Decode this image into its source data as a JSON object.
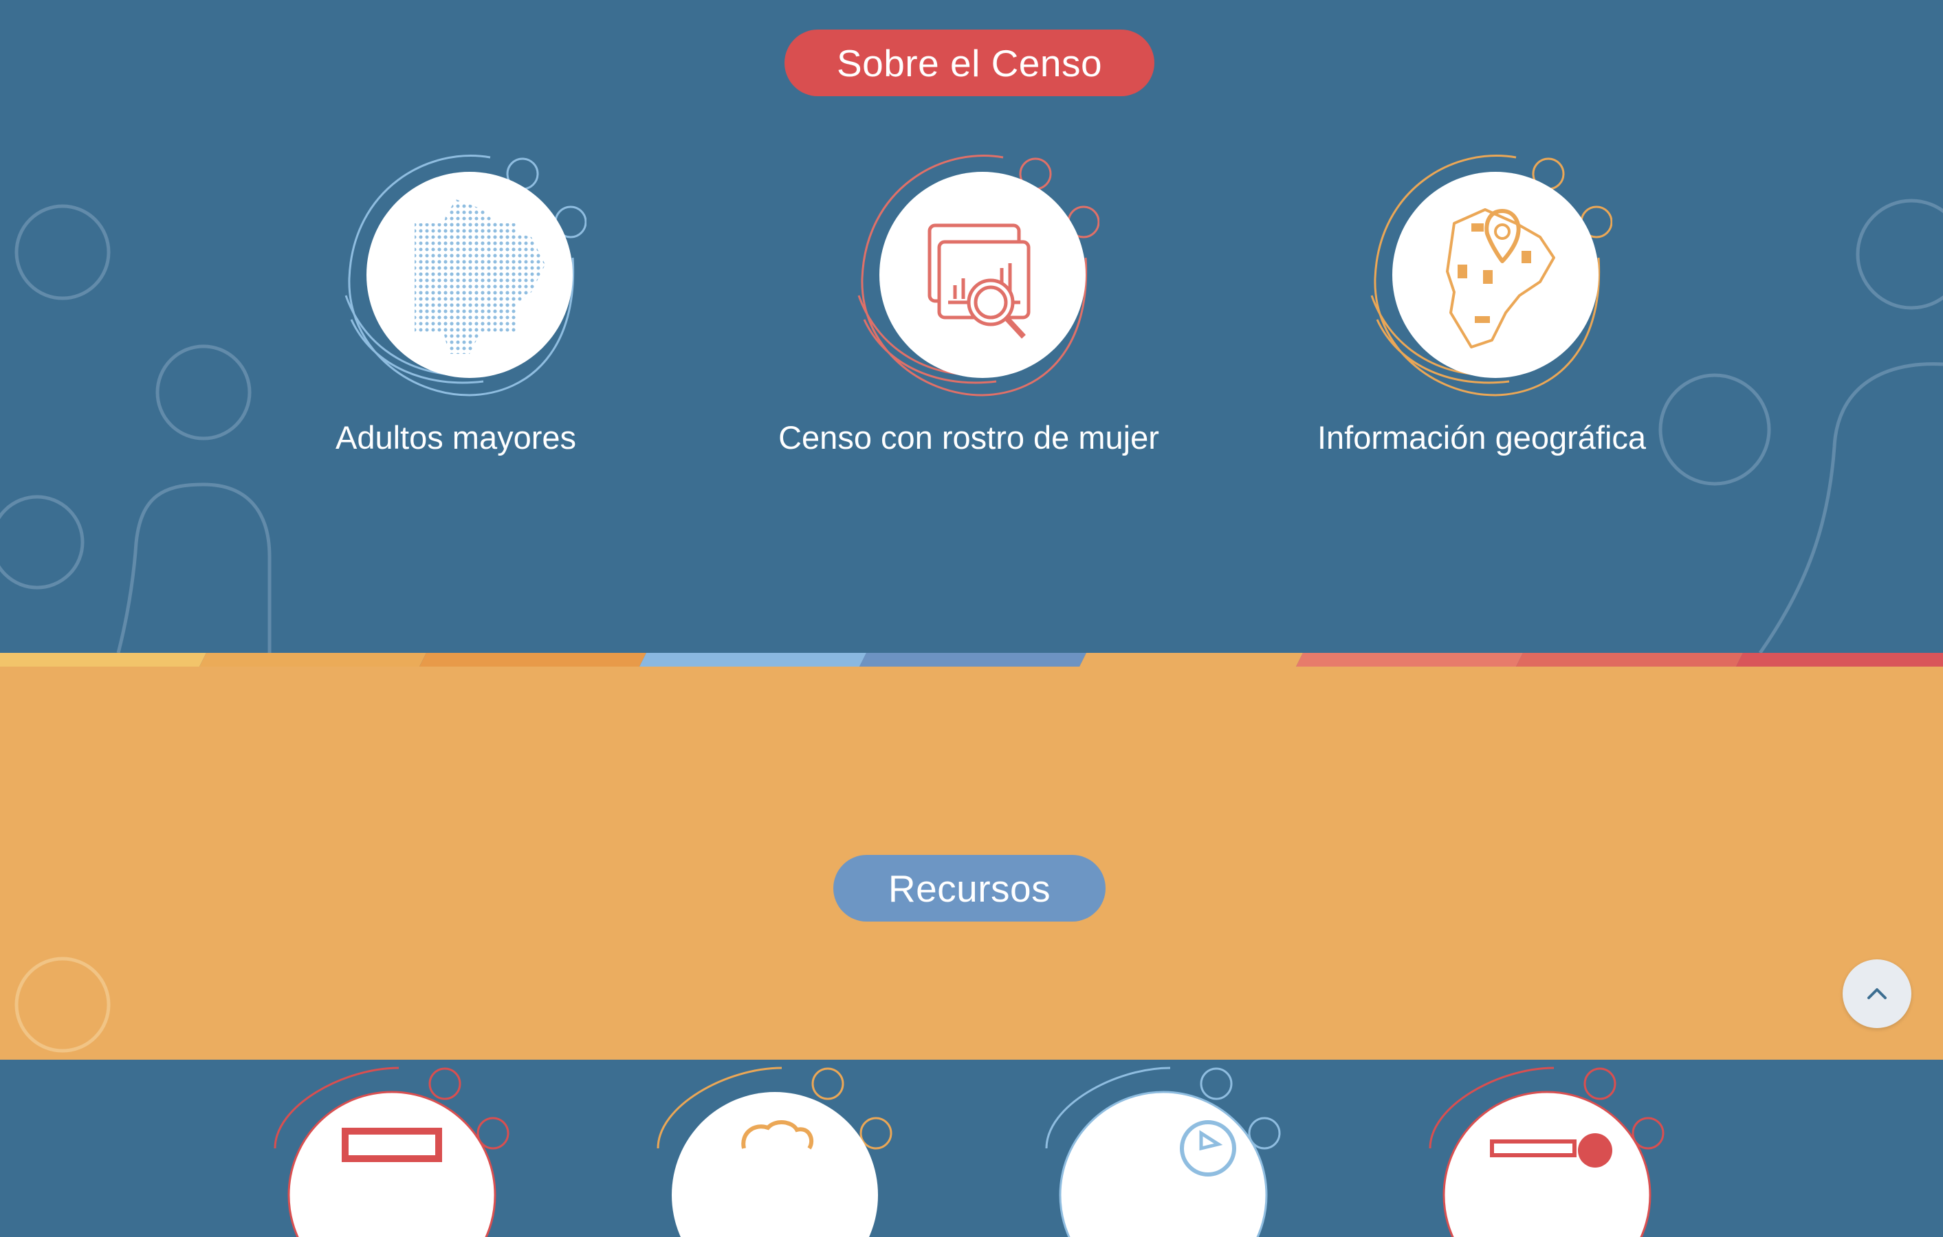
{
  "sections": {
    "about": {
      "title": "Sobre el Censo",
      "cards": [
        {
          "label": "Adultos mayores",
          "icon": "ecuador-dots-map-icon",
          "color": "#8fbde0"
        },
        {
          "label": "Censo con rostro de mujer",
          "icon": "data-analysis-magnifier-icon",
          "color": "#e07068"
        },
        {
          "label": "Información geográfica",
          "icon": "map-location-pin-icon",
          "color": "#eba756"
        }
      ]
    },
    "resources": {
      "title": "Recursos",
      "items": [
        {
          "icon": "monitor-icon",
          "color": "#d94f50"
        },
        {
          "icon": "people-icon",
          "color": "#eba756"
        },
        {
          "icon": "video-play-icon",
          "color": "#8fbde0"
        },
        {
          "icon": "document-pin-icon",
          "color": "#d94f50"
        }
      ]
    }
  },
  "colors": {
    "blue_bg": "#3c6e91",
    "orange_bg": "#ebad60",
    "red_accent": "#d94f50",
    "blue_accent": "#6d96c4"
  },
  "back_to_top_icon": "chevron-up-icon"
}
